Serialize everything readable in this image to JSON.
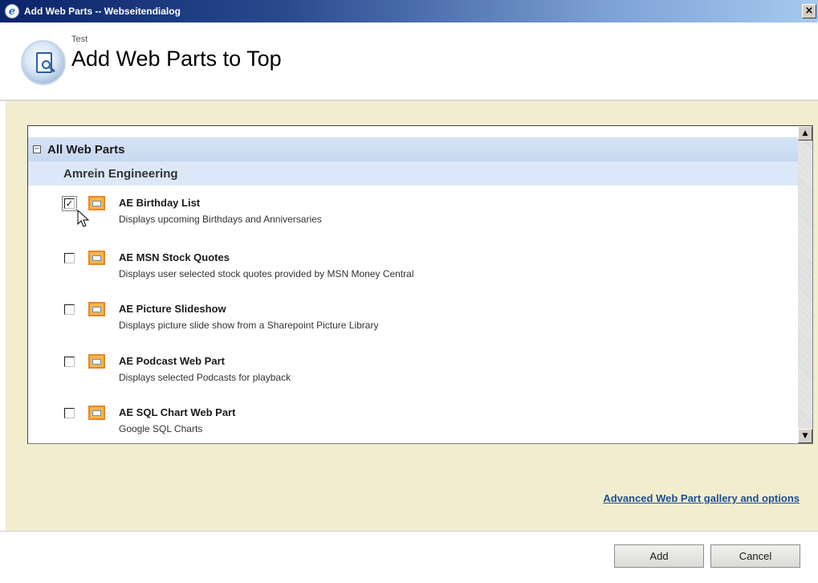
{
  "window": {
    "title": "Add Web Parts -- Webseitendialog",
    "close_glyph": "×",
    "icon": "ie-icon"
  },
  "header": {
    "site": "Test",
    "title": "Add Web Parts to Top",
    "icon": "web-part-gallery-icon"
  },
  "gallery": {
    "group_toggle": "−",
    "group_label": "All Web Parts",
    "category_label": "Amrein Engineering",
    "scroll_up_glyph": "▲",
    "scroll_down_glyph": "▼",
    "items": [
      {
        "name": "AE Birthday List",
        "description": "Displays upcoming Birthdays and Anniversaries",
        "checked": true,
        "check_glyph": "✓"
      },
      {
        "name": "AE MSN Stock Quotes",
        "description": "Displays user selected stock quotes provided by MSN Money Central",
        "checked": false,
        "check_glyph": ""
      },
      {
        "name": "AE Picture Slideshow",
        "description": "Displays picture slide show from a Sharepoint Picture Library",
        "checked": false,
        "check_glyph": ""
      },
      {
        "name": "AE Podcast Web Part",
        "description": "Displays selected Podcasts for playback",
        "checked": false,
        "check_glyph": ""
      },
      {
        "name": "AE SQL Chart Web Part",
        "description": "Google SQL Charts",
        "checked": false,
        "check_glyph": ""
      }
    ]
  },
  "links": {
    "advanced": "Advanced Web Part gallery and options"
  },
  "buttons": {
    "add": "Add",
    "cancel": "Cancel"
  },
  "colors": {
    "titlebar_start": "#0a246a",
    "main_background": "#f2edcf",
    "group_header": "#c6d8f0",
    "link": "#1c4f8f"
  }
}
